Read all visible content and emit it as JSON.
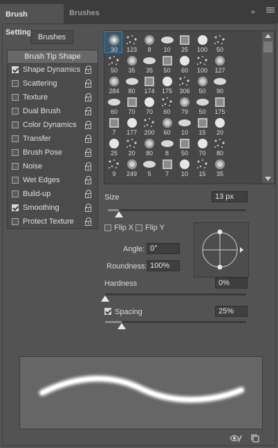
{
  "tabs": [
    {
      "label": "Brush Settings",
      "active": true
    },
    {
      "label": "Brushes",
      "active": false
    }
  ],
  "panel_menu": {
    "collapse": "»",
    "menu": "menu-icon"
  },
  "brushes_button": "Brushes",
  "options": [
    {
      "label": "Brush Tip Shape",
      "selected": true
    },
    {
      "label": "Shape Dynamics",
      "checked": true
    },
    {
      "label": "Scattering",
      "checked": false
    },
    {
      "label": "Texture",
      "checked": false
    },
    {
      "label": "Dual Brush",
      "checked": false
    },
    {
      "label": "Color Dynamics",
      "checked": false
    },
    {
      "label": "Transfer",
      "checked": false
    },
    {
      "label": "Brush Pose",
      "checked": false
    },
    {
      "label": "Noise",
      "checked": false
    },
    {
      "label": "Wet Edges",
      "checked": false
    },
    {
      "label": "Build-up",
      "checked": false
    },
    {
      "label": "Smoothing",
      "checked": true
    },
    {
      "label": "Protect Texture",
      "checked": false
    }
  ],
  "brush_presets": [
    "30",
    "123",
    "8",
    "10",
    "25",
    "100",
    "50",
    "50",
    "35",
    "35",
    "50",
    "60",
    "100",
    "127",
    "284",
    "80",
    "174",
    "175",
    "306",
    "50",
    "90",
    "60",
    "70",
    "70",
    "60",
    "79",
    "50",
    "175",
    "7",
    "177",
    "200",
    "60",
    "10",
    "15",
    "20",
    "25",
    "20",
    "80",
    "8",
    "50",
    "70",
    "80",
    "9",
    "249",
    "5",
    "7",
    "10",
    "15",
    "35"
  ],
  "selected_preset": 0,
  "size": {
    "label": "Size",
    "value": "13 px",
    "fraction": 0.05
  },
  "flip_x": {
    "label": "Flip X",
    "checked": false
  },
  "flip_y": {
    "label": "Flip Y",
    "checked": false
  },
  "angle": {
    "label": "Angle:",
    "value": "0°"
  },
  "roundness": {
    "label": "Roundness:",
    "value": "100%"
  },
  "hardness": {
    "label": "Hardness",
    "value": "0%",
    "fraction": 0.0
  },
  "spacing": {
    "label": "Spacing",
    "value": "25%",
    "checked": true,
    "fraction": 0.12
  },
  "footer": {
    "icon1": "eye-brush-icon",
    "icon2": "new-preset-icon"
  },
  "colors": {
    "panel": "#535353",
    "tabbar": "#3c3c3c",
    "selection": "#1f8ad6"
  }
}
